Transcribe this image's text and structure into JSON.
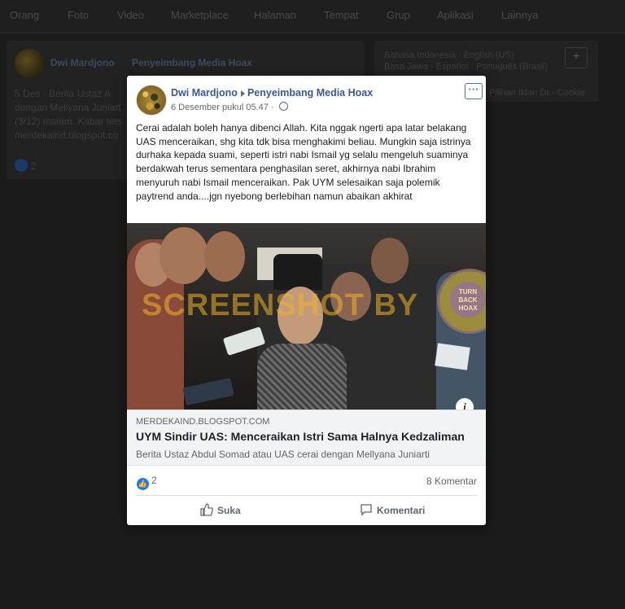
{
  "background": {
    "nav_items": [
      "Orang",
      "Foto",
      "Video",
      "Marketplace",
      "Halaman",
      "Tempat",
      "Grup",
      "Aplikasi",
      "Lainnya"
    ],
    "post_author": "Dwi Mardjono",
    "post_group": "Penyeimbang Media Hoax",
    "post_snippet_lines": [
      "5 Des · Berita Ustaz A",
      "dengan Mellyana Juniart",
      "(3/12) malam. Kabar ters",
      "merdekaind.blogspot.co"
    ],
    "like_count": "2",
    "languages_line1": "Bahasa Indonesia · English (US)",
    "languages_line2": "Basa Jawa · Español · Português (Brasil)",
    "side_text": "Pilihan Iklan Dr · Cookie"
  },
  "post": {
    "author": "Dwi Mardjono",
    "group": "Penyeimbang Media Hoax",
    "timestamp": "6 Desember pukul 05.47 ·",
    "more_label": "···",
    "text": "Cerai adalah boleh hanya dibenci Allah. Kita nggak ngerti apa latar belakang UAS menceraikan, shg kita tdk bisa menghakimi beliau. Mungkin saja istrinya durhaka kepada suami, seperti istri nabi Ismail yg selalu mengeluh suaminya berdakwah terus sementara penghasilan seret, akhirnya nabi Ibrahim menyuruh nabi Ismail menceraikan. Pak UYM selesaikan saja polemik paytrend anda....jgn nyebong berlebihan namun abaikan akhirat",
    "image": {
      "watermark": "SCREENSHOT BY",
      "seal_text": "TURN BACK HOAX",
      "info": "i"
    },
    "link": {
      "domain": "MERDEKAIND.BLOGSPOT.COM",
      "title": "UYM Sindir UAS: Menceraikan Istri Sama Halnya Kedzaliman",
      "description": "Berita Ustaz Abdul Somad atau UAS cerai dengan Mellyana Juniarti"
    },
    "reaction_count": "2",
    "comment_count": "8 Komentar",
    "actions": {
      "like": "Suka",
      "comment": "Komentari"
    }
  },
  "colors": {
    "link_blue": "#385898",
    "like_blue": "#2078f4",
    "overlay": "#1b1b1b"
  }
}
